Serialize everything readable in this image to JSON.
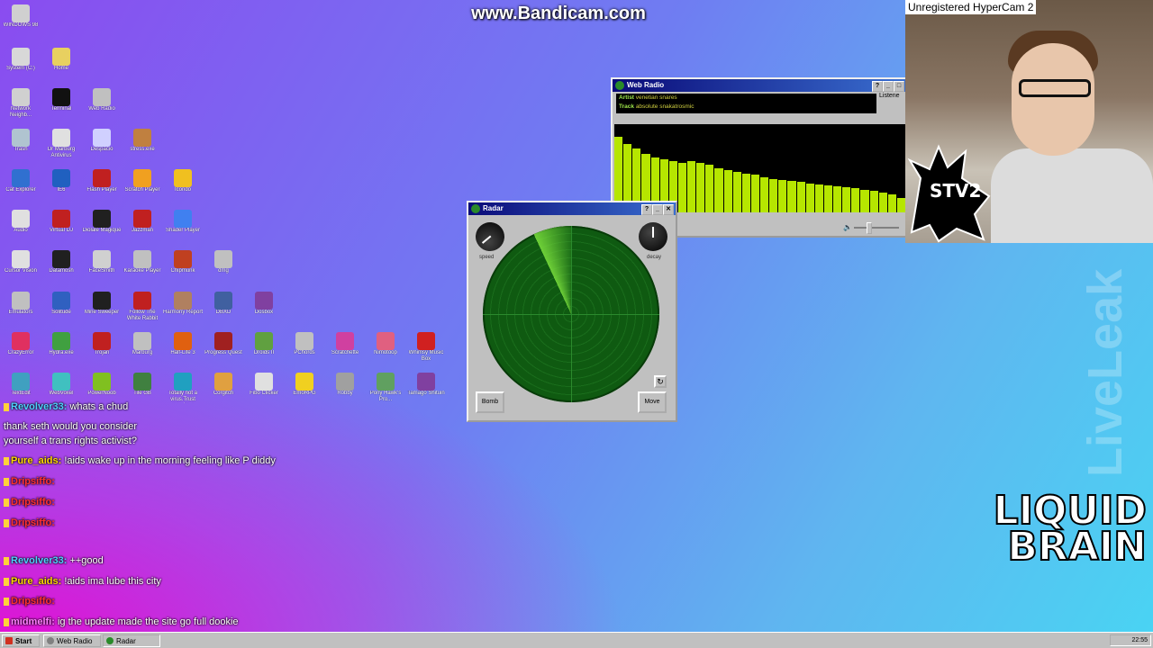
{
  "watermark": "www.Bandicam.com",
  "desktop_icons": [
    {
      "label": "WINDOWS 98",
      "icon": "computer-icon",
      "c": "#d0d0d0"
    },
    {
      "label": "System (C:)",
      "icon": "drive-icon",
      "c": "#d8d8d8"
    },
    {
      "label": "Home",
      "icon": "folder-icon",
      "c": "#e8d060"
    },
    {
      "label": "Network Neighb...",
      "icon": "network-icon",
      "c": "#d0d0d0"
    },
    {
      "label": "Terminal",
      "icon": "terminal-icon",
      "c": "#111111"
    },
    {
      "label": "Web Radio",
      "icon": "radio-icon",
      "c": "#c0c0c0"
    },
    {
      "label": "Trash",
      "icon": "trash-icon",
      "c": "#b0c4d0"
    },
    {
      "label": "Dr Marburg Antivirus",
      "icon": "antivirus-icon",
      "c": "#e0e0e0"
    },
    {
      "label": "Despacio",
      "icon": "brush-icon",
      "c": "#d0d0ff"
    },
    {
      "label": "stress.exe",
      "icon": "hammer-icon",
      "c": "#c08040"
    },
    {
      "label": "Icondo",
      "icon": "pencil-icon",
      "c": "#f0c020"
    },
    {
      "label": "Cat Explorer",
      "icon": "globe-icon",
      "c": "#3070d0"
    },
    {
      "label": "IE6",
      "icon": "ie-icon",
      "c": "#2060c0"
    },
    {
      "label": "Flash Player",
      "icon": "flash-icon",
      "c": "#c02020"
    },
    {
      "label": "Scratch Player",
      "icon": "scratch-icon",
      "c": "#f0a020"
    },
    {
      "label": "Shader Player",
      "icon": "sphere-icon",
      "c": "#4080f0"
    },
    {
      "label": "dmg",
      "icon": "disk-icon",
      "c": "#c0c0c0"
    },
    {
      "label": "Dosbox",
      "icon": "dosbox-icon",
      "c": "#8040a0"
    },
    {
      "label": "Audio",
      "icon": "speaker-icon",
      "c": "#e0e0e0"
    },
    {
      "label": "Virtual DJ",
      "icon": "dj-icon",
      "c": "#c02020"
    },
    {
      "label": "Diolale Magique",
      "icon": "drum-icon",
      "c": "#202020"
    },
    {
      "label": "Jazzman",
      "icon": "jazz-icon",
      "c": "#c02020"
    },
    {
      "label": "Chipmunk",
      "icon": "chipmunk-icon",
      "c": "#c04020"
    },
    {
      "label": "DBXD",
      "icon": "grid-icon",
      "c": "#4060a0"
    },
    {
      "label": "Droids II",
      "icon": "droid-icon",
      "c": "#60a040"
    },
    {
      "label": "PChords",
      "icon": "chords-icon",
      "c": "#c0c0c0"
    },
    {
      "label": "Scratchette",
      "icon": "scratchette-icon",
      "c": "#d040a0"
    },
    {
      "label": "Nimotoop",
      "icon": "nimotoop-icon",
      "c": "#e06080"
    },
    {
      "label": "Whimsy Music Box",
      "icon": "musicbox-icon",
      "c": "#d02020"
    },
    {
      "label": "Cursor Vision",
      "icon": "cursor-icon",
      "c": "#e0e0e0"
    },
    {
      "label": "Datamosh",
      "icon": "eye-icon",
      "c": "#202020"
    },
    {
      "label": "FaceSmith",
      "icon": "face-icon",
      "c": "#d0d0d0"
    },
    {
      "label": "Karaoke Player",
      "icon": "cd-icon",
      "c": "#c0c0c0"
    },
    {
      "label": "Harmony Report",
      "icon": "person-icon",
      "c": "#b08060"
    },
    {
      "label": "Emulators",
      "icon": "emulator-icon",
      "c": "#c0c0c0"
    },
    {
      "label": "Solitude",
      "icon": "bottle-icon",
      "c": "#3060c0"
    },
    {
      "label": "Mine Sweeper",
      "icon": "mine-icon",
      "c": "#202020"
    },
    {
      "label": "Follow The White Rabbit",
      "icon": "rabbit-icon",
      "c": "#c02020"
    },
    {
      "label": "Half-Life 3",
      "icon": "halflife-icon",
      "c": "#e06010"
    },
    {
      "label": "Progress Quest",
      "icon": "sword-icon",
      "c": "#a02020"
    },
    {
      "label": "Fibo Clicker",
      "icon": "fibo-icon",
      "c": "#e0e0e0"
    },
    {
      "label": "EmoRPG",
      "icon": "smiley-icon",
      "c": "#f0d020"
    },
    {
      "label": "Robby",
      "icon": "robot-icon",
      "c": "#a0a0a0"
    },
    {
      "label": "Pony Hawk's Pro...",
      "icon": "pony-icon",
      "c": "#60a060"
    },
    {
      "label": "Tamago Shituin",
      "icon": "tamago-icon",
      "c": "#8040a0"
    },
    {
      "label": "CrazyError",
      "icon": "error-icon",
      "c": "#e03060"
    },
    {
      "label": "Hydra.exe",
      "icon": "hydra-icon",
      "c": "#40a040"
    },
    {
      "label": "Trojan",
      "icon": "trojan-icon",
      "c": "#c02020"
    },
    {
      "label": "Marburg",
      "icon": "monitor-icon",
      "c": "#c0c0c0"
    },
    {
      "label": "Totally not a virus.Trust me...im a dolphin",
      "icon": "dolphin-icon",
      "c": "#20a0c0"
    },
    {
      "label": "Corgitch",
      "icon": "corgi-icon",
      "c": "#e0a040"
    },
    {
      "label": "TextEdit",
      "icon": "textedit-icon",
      "c": "#40a0c0"
    },
    {
      "label": "WebVoxel",
      "icon": "cube-icon",
      "c": "#40c0c0"
    },
    {
      "label": "PowerNoob",
      "icon": "diamond-icon",
      "c": "#80c020"
    },
    {
      "label": "Tile GB",
      "icon": "gameboy-icon",
      "c": "#408040"
    }
  ],
  "web_radio": {
    "title": "Web Radio",
    "artist_label": "Artist",
    "artist": "venetian snares",
    "track_label": "Track",
    "track": "absolute snakatrosmic",
    "listen": "Listene",
    "visualizer": [
      0.86,
      0.78,
      0.72,
      0.66,
      0.62,
      0.6,
      0.58,
      0.56,
      0.58,
      0.56,
      0.54,
      0.5,
      0.48,
      0.46,
      0.44,
      0.43,
      0.4,
      0.38,
      0.37,
      0.36,
      0.35,
      0.33,
      0.32,
      0.31,
      0.3,
      0.29,
      0.28,
      0.26,
      0.24,
      0.22,
      0.2,
      0.16
    ]
  },
  "radar": {
    "title": "Radar",
    "speed_label": "speed",
    "decay_label": "decay",
    "bomb_label": "Bomb",
    "move_label": "Move"
  },
  "chat": [
    {
      "user": "Revolver33:",
      "text": "whats a chud",
      "c": "#4fd1ff"
    },
    {
      "user": "",
      "text": "thank seth would you consider",
      "c": "#ffffff"
    },
    {
      "user": "",
      "text": "yourself a trans rights activist?",
      "c": "#ffffff"
    },
    {
      "user": "Pure_aids:",
      "text": "!aids wake up in the morning feeling like P diddy",
      "c": "#ffd700"
    },
    {
      "user": "Dripsiffo:",
      "text": "",
      "c": "#ff3030"
    },
    {
      "user": "Dripsiffo:",
      "text": "",
      "c": "#ff3030"
    },
    {
      "user": "Dripsiffo:",
      "text": "",
      "c": "#ff3030"
    },
    {
      "user": "Revolver33:",
      "text": "++good",
      "c": "#4fd1ff"
    },
    {
      "user": "Pure_aids:",
      "text": "!aids ima lube this city",
      "c": "#ffd700"
    },
    {
      "user": "Dripsiffo:",
      "text": "",
      "c": "#ff3030"
    },
    {
      "user": "midmelfi:",
      "text": "ig the update made the site go full dookie",
      "c": "#ff80ff"
    }
  ],
  "hypercam": "Unregistered HyperCam 2",
  "stv2": "STV2",
  "liveleak": "LiveLeak",
  "liquid_brain": [
    "LIQUID",
    "BRAIN"
  ],
  "taskbar": {
    "start": "Start",
    "tasks": [
      "Web Radio",
      "Radar"
    ],
    "clock": "22:55"
  }
}
